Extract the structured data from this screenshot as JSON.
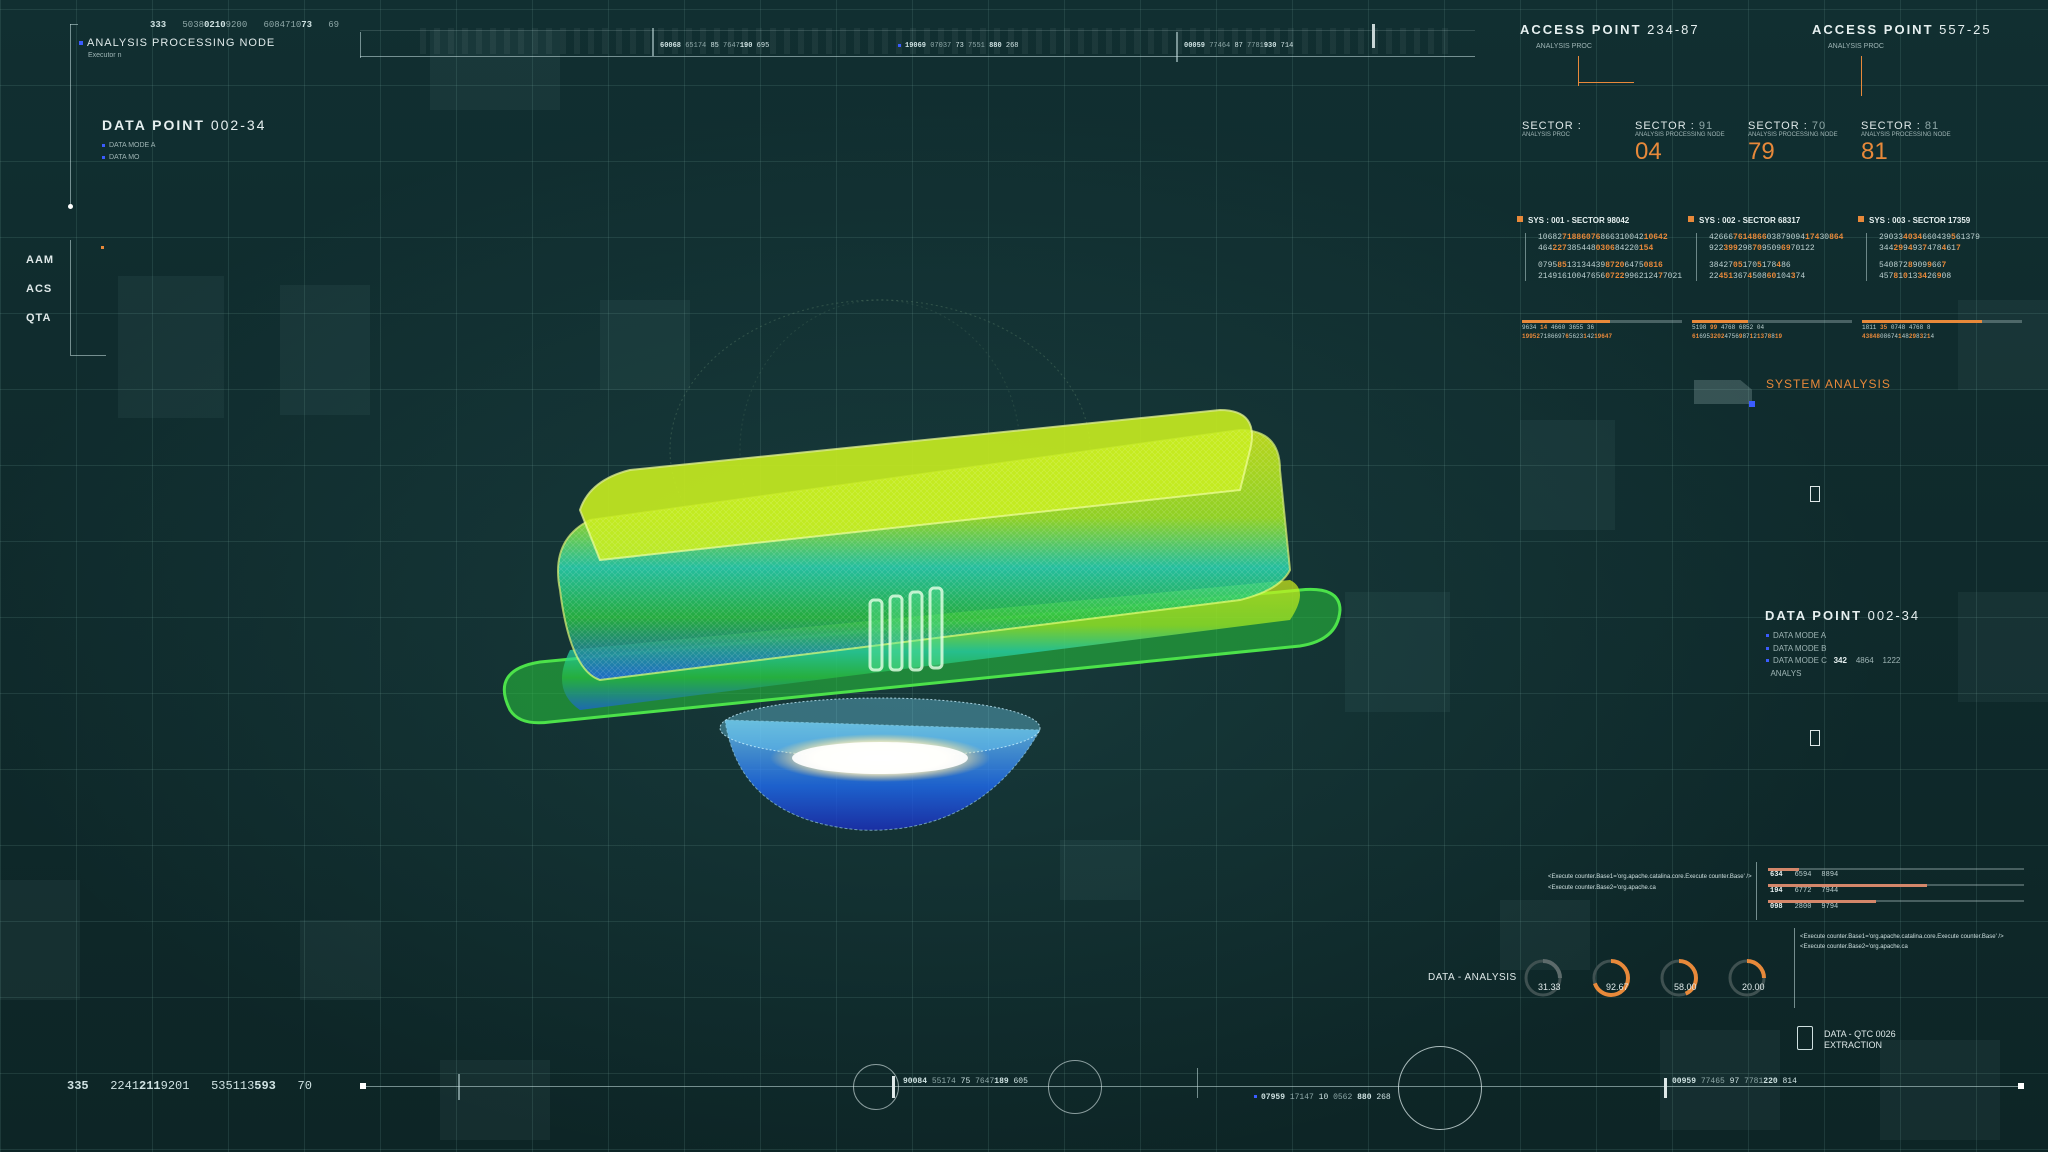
{
  "top_left": {
    "readout_small": [
      "333",
      "5038",
      "0210",
      "9200",
      "6084710",
      "73",
      "69"
    ],
    "node_title": "ANALYSIS PROCESSING NODE",
    "node_sub": "Executor n",
    "dp_title_a": "DATA POINT",
    "dp_title_b": "002-34",
    "dp_items": [
      "DATA MODE A",
      "DATA MO"
    ],
    "side_labels": [
      "AAM",
      "ACS",
      "QTA"
    ]
  },
  "top_bar": {
    "seg1": [
      "60068",
      "65174",
      "85",
      "7647",
      "190",
      "695"
    ],
    "seg2": [
      "19069",
      "07037",
      "73",
      "7551",
      "880",
      "268"
    ],
    "seg3": [
      "00059",
      "77464",
      "87",
      "7781",
      "930",
      "714"
    ]
  },
  "access_points": [
    {
      "label": "ACCESS POINT",
      "value": "234-87",
      "sub": "ANALYSIS PROC"
    },
    {
      "label": "ACCESS POINT",
      "value": "557-25",
      "sub": "ANALYSIS PROC"
    }
  ],
  "sectors": [
    {
      "label": "SECTOR :",
      "num": "",
      "sub": "ANALYSIS PROC",
      "value": ""
    },
    {
      "label": "SECTOR :",
      "num": "91",
      "sub": "ANALYSIS PROCESSING NODE",
      "value": "04"
    },
    {
      "label": "SECTOR :",
      "num": "70",
      "sub": "ANALYSIS PROCESSING NODE",
      "value": "79"
    },
    {
      "label": "SECTOR :",
      "num": "81",
      "sub": "ANALYSIS PROCESSING NODE",
      "value": "81"
    }
  ],
  "sys_blocks": [
    {
      "title": "SYS : 001 - SECTOR 98042",
      "rows": [
        [
          "10682",
          "71886076",
          "8663",
          "10042",
          "10642"
        ],
        [
          "464",
          "227",
          "3854",
          "48",
          "0306",
          "8",
          "4220",
          "154"
        ],
        [
          "0795",
          "85",
          "1313",
          "4439",
          "8720",
          "6",
          "475",
          "0816"
        ],
        [
          "21491",
          "",
          "61004",
          "7656",
          "0722",
          "99621",
          "24",
          "7",
          "7021"
        ]
      ]
    },
    {
      "title": "SYS : 002 - SECTOR 68317",
      "rows": [
        [
          "42666",
          "7614866",
          "0387",
          "9094",
          "174",
          "3",
          "0",
          "864"
        ],
        [
          "922",
          "399",
          "",
          "298",
          "70",
          "95",
          "09",
          "69",
          "701",
          "22"
        ],
        [
          "38427",
          "05",
          "17",
          "0",
          "5",
          "1",
          "78",
          "4",
          "8",
          "6"
        ],
        [
          "22",
          "451",
          "",
          "367",
          "4",
          "50",
          "8",
          "60",
          "1",
          "04",
          "3",
          "7",
          "4"
        ]
      ]
    },
    {
      "title": "SYS : 003 - SECTOR 17359",
      "rows": [
        [
          "29033",
          "4034",
          "66043",
          "9",
          "5",
          "6137",
          "9"
        ],
        [
          "344",
          "29",
          "",
          "9",
          "4",
          "9",
          "3",
          "7",
          "4",
          "78",
          "4",
          "6",
          "1",
          "7"
        ],
        [
          "5408",
          "",
          "7",
          "2",
          "8",
          "9",
          "09",
          "9",
          "6",
          "6",
          "7"
        ],
        [
          "457",
          "8",
          "",
          "1",
          "0",
          "1",
          "3",
          "34",
          "2",
          "6",
          "9",
          "0",
          "8"
        ]
      ]
    }
  ],
  "mini_bars": [
    {
      "pct": 0.55,
      "readout": [
        "9634",
        "14",
        "4660",
        "3655",
        "36"
      ],
      "readout2": [
        "19952",
        "7186697",
        "6",
        "5623",
        "1",
        "42",
        "19647"
      ]
    },
    {
      "pct": 0.35,
      "readout": [
        "5198",
        "99",
        "4768",
        "6852",
        "04"
      ],
      "readout2": [
        "61",
        "695",
        "3202",
        "4756",
        "9",
        "87",
        "1",
        "2",
        "13",
        "7",
        "8",
        "8",
        "19"
      ]
    },
    {
      "pct": 0.75,
      "readout": [
        "1811",
        "35",
        "0748",
        "4768",
        "8"
      ],
      "readout2": [
        "43848",
        "08674",
        "1",
        "48",
        "29",
        "8",
        "3",
        "2",
        "1",
        "4"
      ]
    }
  ],
  "system_analysis": "SYSTEM ANALYSIS",
  "right_dp": {
    "title_a": "DATA POINT",
    "title_b": "002-34",
    "items": [
      "DATA MODE A",
      "DATA MODE B",
      "DATA MODE C"
    ],
    "item_c_values": [
      "342",
      "4864",
      "1222"
    ],
    "tail": "ANALYS"
  },
  "code_lines_a": [
    "<Execute counter.Base1='org.apache.catalina.core.Execute counter.Base' />",
    "<Execute counter.Base2='org.apache.ca"
  ],
  "code_lines_b": [
    "<Execute counter.Base1='org.apache.catalina.core.Execute counter.Base' />",
    "<Execute counter.Base2='org.apache.ca"
  ],
  "progress_rows": [
    {
      "a": "634",
      "b": "6594",
      "c": "8894",
      "pct": 0.12
    },
    {
      "a": "194",
      "b": "6772",
      "c": "7944",
      "pct": 0.62
    },
    {
      "a": "098",
      "b": "2800",
      "c": "9794",
      "pct": 0.42
    }
  ],
  "gauges": {
    "label": "DATA - ANALYSIS",
    "items": [
      {
        "value": "31.33",
        "pct": 0.31,
        "color": "#5d6b6b"
      },
      {
        "value": "92.67",
        "pct": 0.93,
        "color": "#e8893a"
      },
      {
        "value": "58.00",
        "pct": 0.58,
        "color": "#e8893a"
      },
      {
        "value": "20.00",
        "pct": 0.2,
        "color": "#e8893a"
      }
    ]
  },
  "extraction": {
    "line1": "DATA - QTC 0026",
    "line2": "EXTRACTION"
  },
  "bottom": {
    "left_readout": [
      "335",
      "2241",
      "211",
      "9201",
      "535113",
      "593",
      "70"
    ],
    "seg1": [
      "90084",
      "55174",
      "75",
      "7647",
      "189",
      "605"
    ],
    "seg2": [
      "07959",
      "17147",
      "10",
      "0562",
      "880",
      "268"
    ],
    "seg3": [
      "00959",
      "77465",
      "97",
      "7781",
      "220",
      "814"
    ]
  },
  "colors": {
    "accent": "#e8893a",
    "blue": "#3b5cff",
    "bg": "#0f2a2b"
  }
}
